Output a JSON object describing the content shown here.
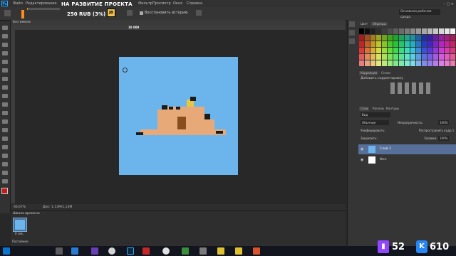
{
  "app": {
    "logo_text": "Ps"
  },
  "menu": [
    "Файл",
    "Редактирование",
    "Фильтр",
    "Просмотр",
    "Окно",
    "Справка"
  ],
  "overlay": {
    "title": "НА РАЗВИТИЕ ПРОЕКТА",
    "subtitle": "250 RUB (3%)",
    "progress_percent": 3,
    "jb": "JB"
  },
  "options": {
    "restore_label": "Восстановить историю",
    "workspace": "Основная рабочая среда"
  },
  "document": {
    "tab_title": "Без имени",
    "zoom_readout": "10 000"
  },
  "status": {
    "zoom": "66,67%",
    "doc": "Док: 1,13М/1,13М"
  },
  "timeline": {
    "title": "Шкала времени",
    "frame_time": "0 сек.",
    "loop": "Постоянно"
  },
  "panels": {
    "color_tabs": [
      "Цвет",
      "Образцы"
    ],
    "adjust_tabs": [
      "Коррекция",
      "Стили"
    ],
    "adjust_label": "Добавить корректировку",
    "layers_tabs": [
      "Слои",
      "Каналы",
      "Контуры"
    ],
    "kind": "Вид",
    "blend": "Обычные",
    "opacity_label": "Непрозрачность:",
    "opacity": "100%",
    "unify_label": "Унифицировать:",
    "propagate": "Распространить кадр 1",
    "lock_label": "Закрепить:",
    "fill_label": "Заливка:",
    "fill": "100%",
    "layers": [
      "Слой 1",
      "Фон"
    ]
  },
  "stream": {
    "twitch_count": "52",
    "vk_count": "610",
    "twitch_mark": "▮"
  },
  "colors": {
    "accent": "#31a8ff",
    "canvas": "#6cb5ec",
    "taskbar": "#12151d",
    "twitch": "#9146ff"
  }
}
